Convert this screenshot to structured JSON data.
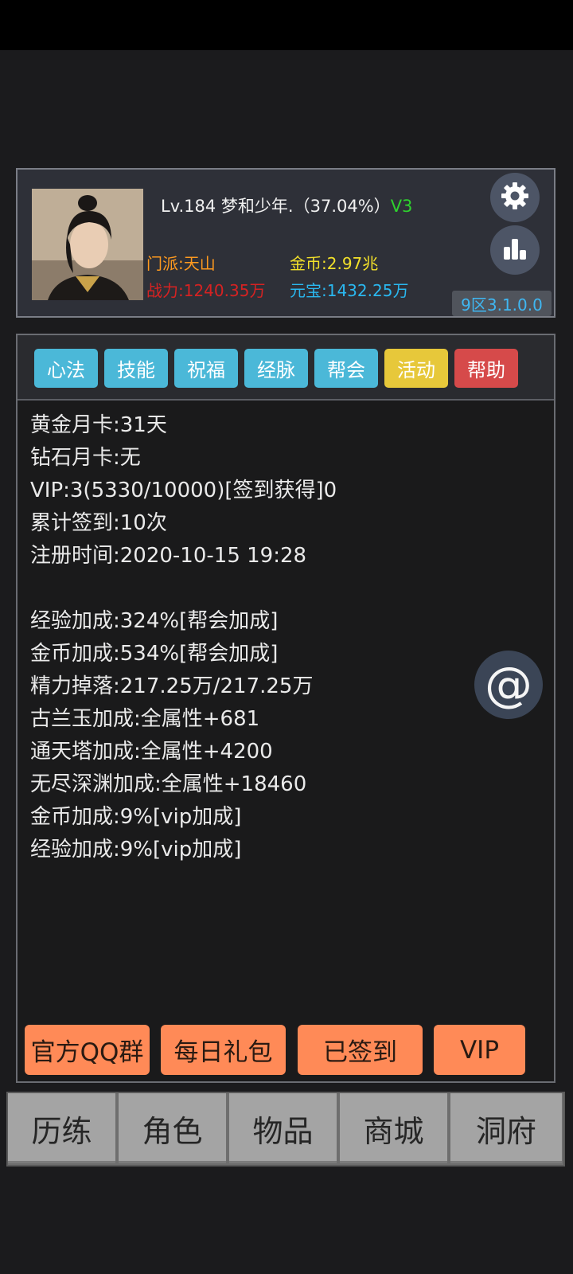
{
  "header": {
    "name_line": "Lv.184 梦和少年.（37.04%）",
    "vip_badge": "V3",
    "sect": "门派:天山",
    "gold": "金币:2.97兆",
    "power": "战力:1240.35万",
    "yuanbao": "元宝:1432.25万",
    "server": "9区3.1.0.0",
    "settings_icon": "gear-icon",
    "stats_icon": "bar-chart-icon"
  },
  "tabs": [
    {
      "label": "心法",
      "color": "#4bb8d8"
    },
    {
      "label": "技能",
      "color": "#4bb8d8"
    },
    {
      "label": "祝福",
      "color": "#4bb8d8"
    },
    {
      "label": "经脉",
      "color": "#4bb8d8"
    },
    {
      "label": "帮会",
      "color": "#4bb8d8"
    },
    {
      "label": "活动",
      "color": "#e7c83a"
    },
    {
      "label": "帮助",
      "color": "#d64a4a"
    }
  ],
  "info": {
    "block1": [
      "黄金月卡:31天",
      "钻石月卡:无",
      "VIP:3(5330/10000)[签到获得]0",
      "累计签到:10次",
      "注册时间:2020-10-15 19:28"
    ],
    "block2": [
      "经验加成:324%[帮会加成]",
      "金币加成:534%[帮会加成]",
      "精力掉落:217.25万/217.25万",
      "古兰玉加成:全属性+681",
      "通天塔加成:全属性+4200",
      "无尽深渊加成:全属性+18460",
      "金币加成:9%[vip加成]",
      "经验加成:9%[vip加成]"
    ]
  },
  "floating": {
    "at_symbol": "@"
  },
  "actions": [
    "官方QQ群",
    "每日礼包",
    "已签到",
    "VIP"
  ],
  "nav": [
    "历练",
    "角色",
    "物品",
    "商城",
    "洞府"
  ]
}
